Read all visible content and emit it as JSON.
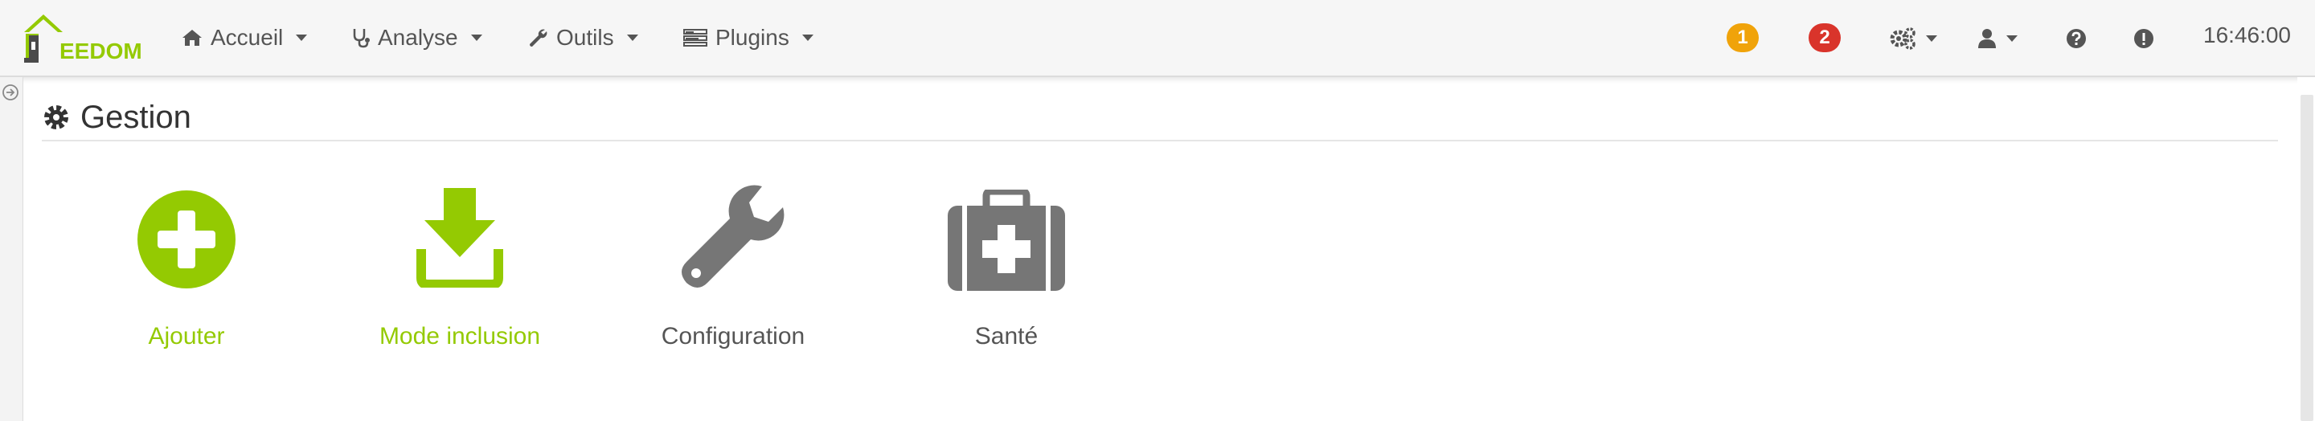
{
  "app": {
    "logo_text": "EEDOM"
  },
  "navbar": {
    "menus": [
      {
        "label": "Accueil",
        "icon": "home-icon"
      },
      {
        "label": "Analyse",
        "icon": "stethoscope-icon"
      },
      {
        "label": "Outils",
        "icon": "wrench-icon"
      },
      {
        "label": "Plugins",
        "icon": "tasks-icon"
      }
    ],
    "badges": [
      {
        "count": "1",
        "color": "#f0a30a"
      },
      {
        "count": "2",
        "color": "#d9342b"
      }
    ],
    "right_icons": [
      "cogs-icon",
      "user-icon",
      "question-icon",
      "exclamation-icon"
    ],
    "clock": "16:46:00"
  },
  "section": {
    "title": "Gestion",
    "icon": "gear-icon"
  },
  "cards": [
    {
      "label": "Ajouter",
      "icon": "plus-circle-icon",
      "color": "#94ca02"
    },
    {
      "label": "Mode inclusion",
      "icon": "download-icon",
      "color": "#94ca02"
    },
    {
      "label": "Configuration",
      "icon": "wrench-icon",
      "color": "#767676"
    },
    {
      "label": "Santé",
      "icon": "medkit-icon",
      "color": "#767676"
    }
  ]
}
